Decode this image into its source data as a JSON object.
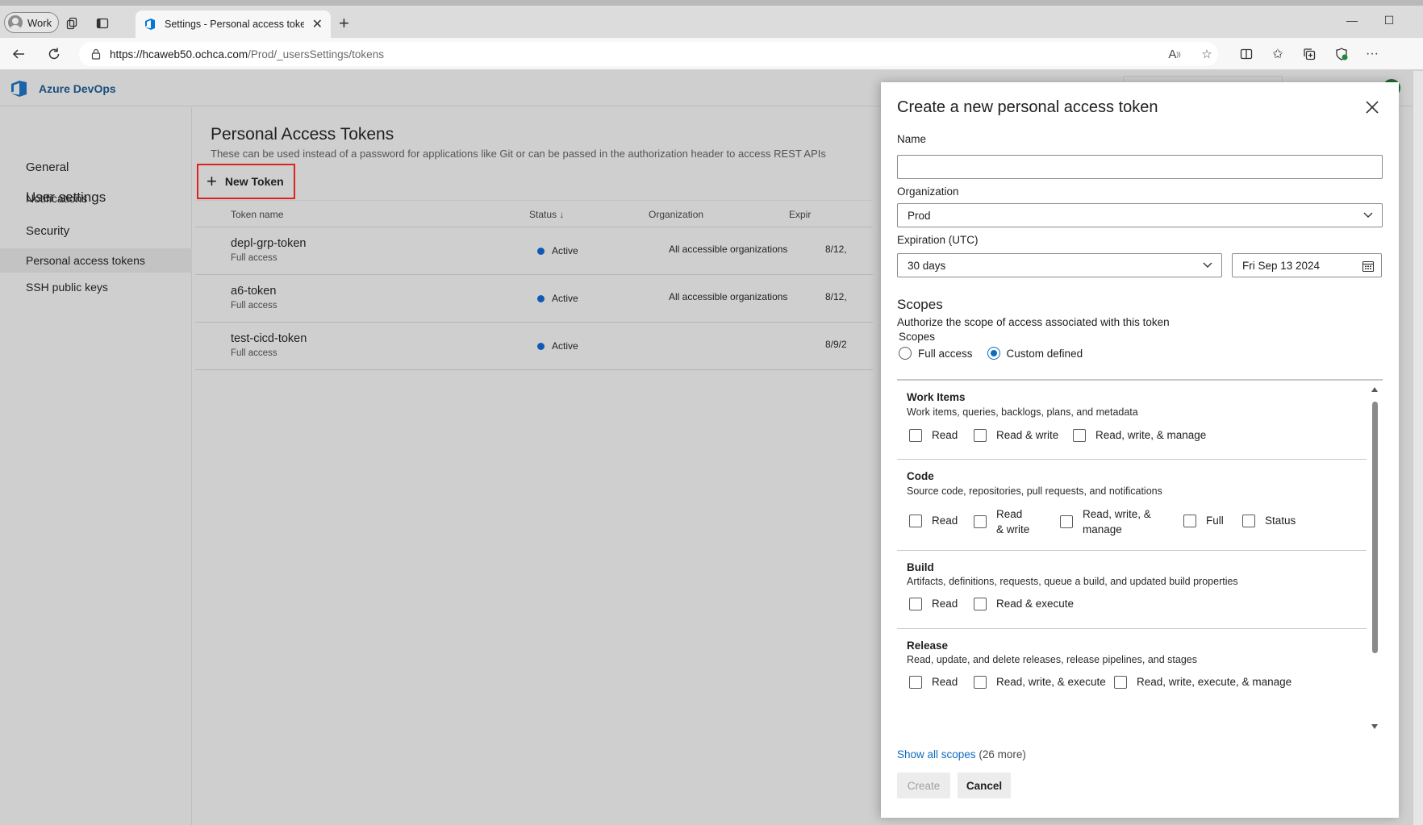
{
  "browser": {
    "profile_label": "Work",
    "tab_title": "Settings - Personal access tokens",
    "url_host": "https://hcaweb50.ochca.com",
    "url_path": "/Prod/_usersSettings/tokens"
  },
  "app": {
    "brand": "Azure DevOps",
    "brand_color": "#0078d4"
  },
  "sidebar": {
    "title": "User settings",
    "section_general": "General",
    "item_notifications": "Notifications",
    "section_security": "Security",
    "item_pat": "Personal access tokens",
    "item_ssh": "SSH public keys"
  },
  "page": {
    "title": "Personal Access Tokens",
    "subtitle": "These can be used instead of a password for applications like Git or can be passed in the authorization header to access REST APIs",
    "new_token_label": "New Token"
  },
  "table": {
    "col_name": "Token name",
    "col_status": "Status",
    "col_org": "Organization",
    "col_exp": "Expir",
    "rows": [
      {
        "name": "depl-grp-token",
        "access": "Full access",
        "status": "Active",
        "org": "All accessible organizations",
        "exp": "8/12,"
      },
      {
        "name": "a6-token",
        "access": "Full access",
        "status": "Active",
        "org": "All accessible organizations",
        "exp": "8/12,"
      },
      {
        "name": "test-cicd-token",
        "access": "Full access",
        "status": "Active",
        "org": "",
        "exp": "8/9/2"
      }
    ]
  },
  "panel": {
    "title": "Create a new personal access token",
    "name_label": "Name",
    "name_value": "",
    "org_label": "Organization",
    "org_value": "Prod",
    "exp_label": "Expiration (UTC)",
    "exp_value": "30 days",
    "date_value": "Fri Sep 13 2024",
    "scopes_heading": "Scopes",
    "scopes_desc": "Authorize the scope of access associated with this token",
    "scopes_sublabel": "Scopes",
    "radio_full": "Full access",
    "radio_custom": "Custom defined",
    "radio_selected": "Custom defined",
    "sections": [
      {
        "name": "Work Items",
        "desc": "Work items, queries, backlogs, plans, and metadata",
        "options": [
          "Read",
          "Read & write",
          "Read, write, & manage"
        ]
      },
      {
        "name": "Code",
        "desc": "Source code, repositories, pull requests, and notifications",
        "options": [
          "Read",
          "Read & write",
          "Read, write, & manage",
          "Full",
          "Status"
        ]
      },
      {
        "name": "Build",
        "desc": "Artifacts, definitions, requests, queue a build, and updated build properties",
        "options": [
          "Read",
          "Read & execute"
        ]
      },
      {
        "name": "Release",
        "desc": "Read, update, and delete releases, release pipelines, and stages",
        "options": [
          "Read",
          "Read, write, & execute",
          "Read, write, execute, & manage"
        ]
      }
    ],
    "show_all_link": "Show all scopes",
    "show_all_count": "(26 more)",
    "create_label": "Create",
    "cancel_label": "Cancel"
  }
}
